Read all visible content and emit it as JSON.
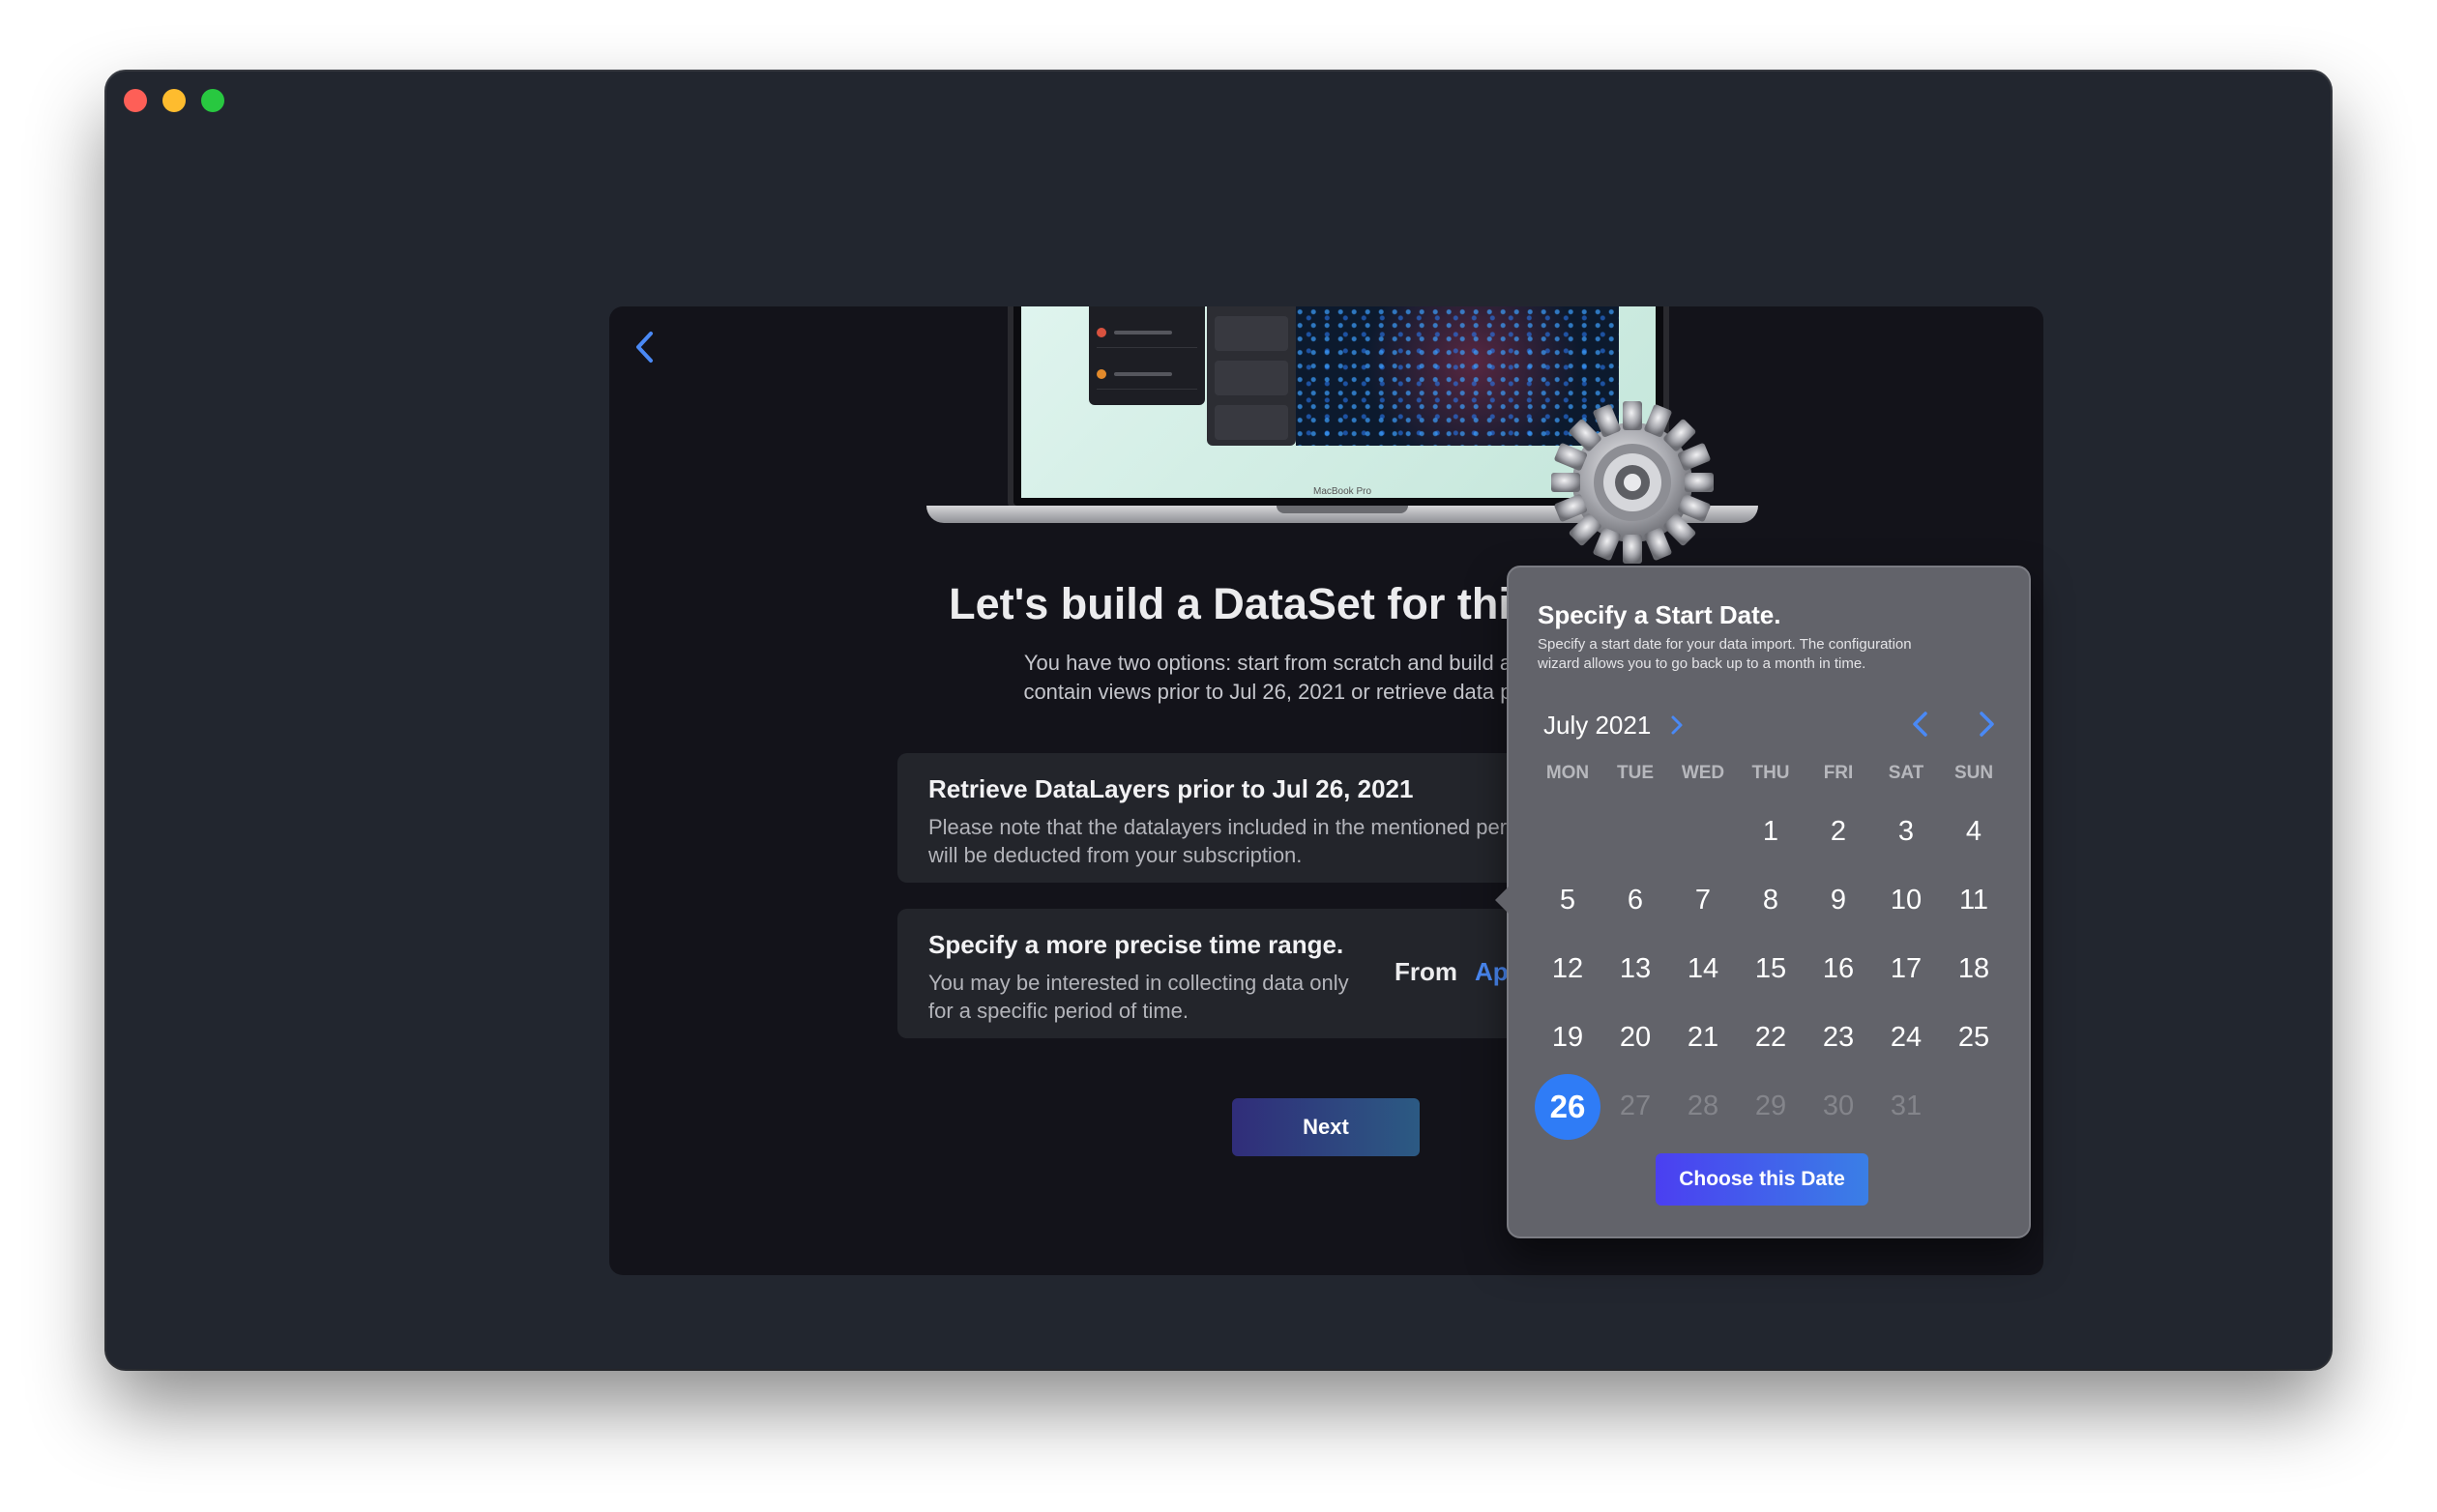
{
  "window": {
    "controls": [
      "close",
      "minimize",
      "zoom"
    ]
  },
  "hero": {
    "device_label": "MacBook Pro"
  },
  "main": {
    "title": "Let's build a DataSet for this project.",
    "subtitle_line1": "You have two options: start from scratch and build a dataset that",
    "subtitle_line2": "contain views prior to Jul 26, 2021 or retrieve data prior to Jul 26",
    "option_retrieve": {
      "title": "Retrieve DataLayers prior to Jul 26, 2021",
      "description": "Please note that the datalayers included in the mentioned period will be deducted from your subscription.",
      "toggle_on": true
    },
    "option_range": {
      "title": "Specify a more precise time range.",
      "description": "You may be interested in collecting data only for a specific period of time.",
      "from_label": "From",
      "from_value": "Apr 26"
    },
    "next_label": "Next"
  },
  "date_popover": {
    "title": "Specify a Start Date.",
    "description": "Specify a start date for your data import. The configuration wizard allows you to go back up to a month in time.",
    "month_label": "July 2021",
    "weekdays": [
      "MON",
      "TUE",
      "WED",
      "THU",
      "FRI",
      "SAT",
      "SUN"
    ],
    "weeks": [
      [
        "",
        "",
        "",
        "1",
        "2",
        "3",
        "4"
      ],
      [
        "5",
        "6",
        "7",
        "8",
        "9",
        "10",
        "11"
      ],
      [
        "12",
        "13",
        "14",
        "15",
        "16",
        "17",
        "18"
      ],
      [
        "19",
        "20",
        "21",
        "22",
        "23",
        "24",
        "25"
      ],
      [
        "26",
        "27",
        "28",
        "29",
        "30",
        "31",
        ""
      ]
    ],
    "selected_day": "26",
    "disabled_days": [
      "27",
      "28",
      "29",
      "30",
      "31"
    ],
    "choose_label": "Choose this Date"
  },
  "colors": {
    "accent": "#2f7cf6",
    "link": "#4a89f5",
    "window_bg": "#22262f",
    "panel_bg": "#13131a",
    "popover_bg": "#62636a"
  }
}
